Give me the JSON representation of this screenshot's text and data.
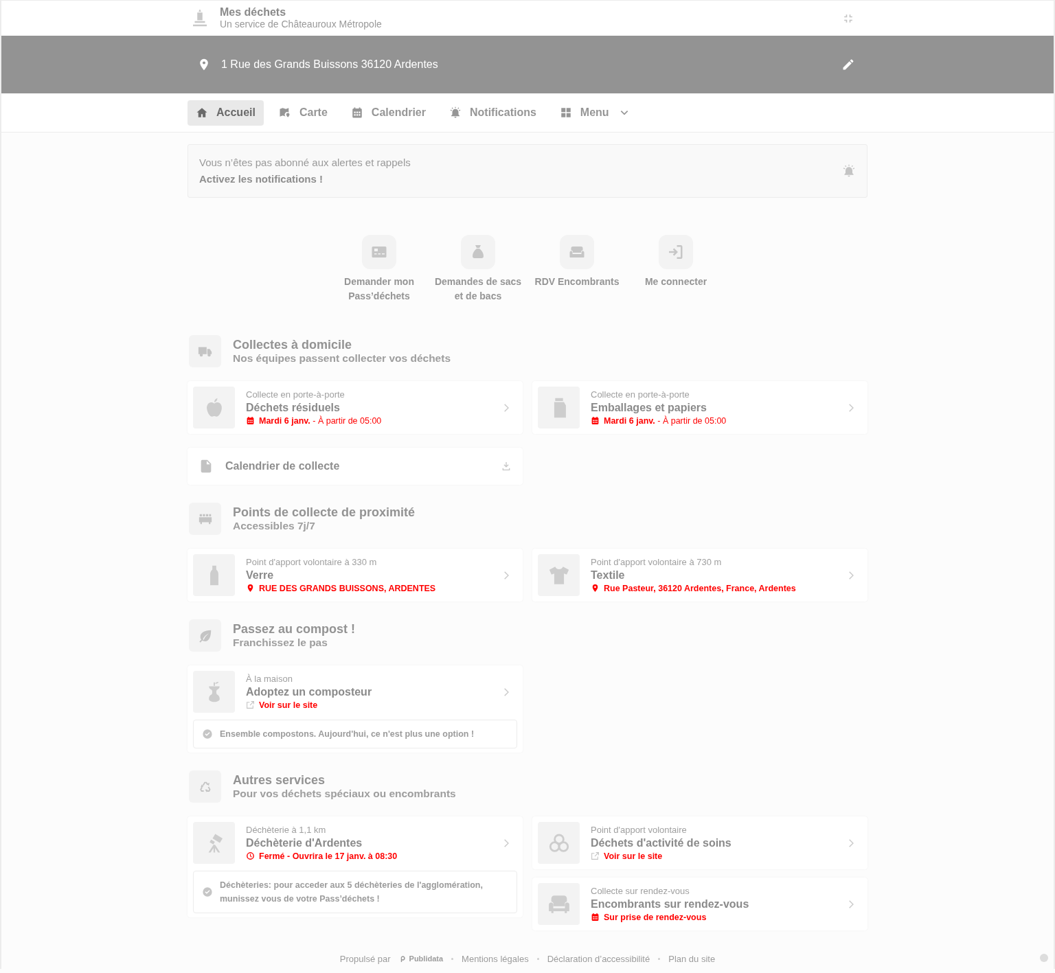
{
  "header": {
    "title": "Mes déchets",
    "subtitle": "Un service de Châteauroux Métropole"
  },
  "address": {
    "value": "1 Rue des Grands Buissons 36120 Ardentes"
  },
  "nav": [
    {
      "label": "Accueil",
      "selected": true
    },
    {
      "label": "Carte",
      "selected": false
    },
    {
      "label": "Calendrier",
      "selected": false
    },
    {
      "label": "Notifications",
      "selected": false
    },
    {
      "label": "Menu",
      "selected": false,
      "expanded": false
    }
  ],
  "alert": {
    "message": "Vous n’êtes pas abonné aux alertes et rappels",
    "action": "Activez les notifications !"
  },
  "quick_actions": [
    {
      "label": "Demander mon Pass’déchets"
    },
    {
      "label": "Demandes de sacs et de bacs"
    },
    {
      "label": "RDV Encombrants"
    },
    {
      "label": "Me connecter"
    }
  ],
  "sections": [
    {
      "title": "Collectes à domicile",
      "subtitle": "Nos équipes passent collecter vos déchets",
      "columns": [
        {
          "cards": [
            {
              "kind": "service",
              "label": "Collecte en porte-à-porte",
              "title": "Déchets résiduels",
              "detail": {
                "kind": "date",
                "text": "**Mardi 6 janv.** - À partir de 05:00"
              }
            },
            {
              "kind": "download",
              "title": "Calendrier de collecte"
            }
          ]
        },
        {
          "cards": [
            {
              "kind": "service",
              "label": "Collecte en porte-à-porte",
              "title": "Emballages et papiers",
              "detail": {
                "kind": "date",
                "text": "**Mardi 6 janv.** - À partir de 05:00"
              }
            }
          ]
        }
      ]
    },
    {
      "title": "Points de collecte de proximité",
      "subtitle": "Accessibles 7j/7",
      "columns": [
        {
          "cards": [
            {
              "kind": "service",
              "label": "Point d'apport volontaire à 330 m",
              "title": "Verre",
              "detail": {
                "kind": "address",
                "text": "RUE DES GRANDS BUISSONS, ARDENTES"
              }
            }
          ]
        },
        {
          "cards": [
            {
              "kind": "service",
              "label": "Point d'apport volontaire à 730 m",
              "title": "Textile",
              "detail": {
                "kind": "address",
                "text": "Rue Pasteur, 36120 Ardentes, France, Ardentes"
              }
            }
          ]
        }
      ]
    },
    {
      "title": "Passez au compost !",
      "subtitle": "Franchissez le pas",
      "columns": [
        {
          "cards": [
            {
              "kind": "service",
              "label": "À la maison",
              "title": "Adoptez un composteur",
              "detail": {
                "kind": "link",
                "text": "Voir sur le site"
              },
              "note": "Ensemble compostons. Aujourd'hui, ce n'est plus une option !"
            }
          ]
        }
      ]
    },
    {
      "title": "Autres services",
      "subtitle": "Pour vos déchets spéciaux ou encombrants",
      "columns": [
        {
          "cards": [
            {
              "kind": "service",
              "label": "Déchèterie à 1,1 km",
              "title": "Déchèterie d'Ardentes",
              "detail": {
                "kind": "hours",
                "text": "Fermé - Ouvrira le 17 janv. à 08:30"
              },
              "note": "Déchèteries: pour acceder aux 5 déchèteries de l'agglomération, munissez vous de votre Pass’déchets !"
            }
          ]
        },
        {
          "cards": [
            {
              "kind": "service",
              "label": "Point d'apport volontaire",
              "title": "Déchets d'activité de soins",
              "detail": {
                "kind": "link",
                "text": "Voir sur le site"
              }
            },
            {
              "kind": "service",
              "label": "Collecte sur rendez-vous",
              "title": "Encombrants sur rendez-vous",
              "detail": {
                "kind": "appointment",
                "text": "Sur prise de rendez-vous"
              }
            }
          ]
        }
      ]
    }
  ],
  "footer": {
    "powered_by": "Propulsé par",
    "brand": "Publidata",
    "links": [
      "Mentions légales",
      "Déclaration d’accessibilité",
      "Plan du site"
    ]
  }
}
